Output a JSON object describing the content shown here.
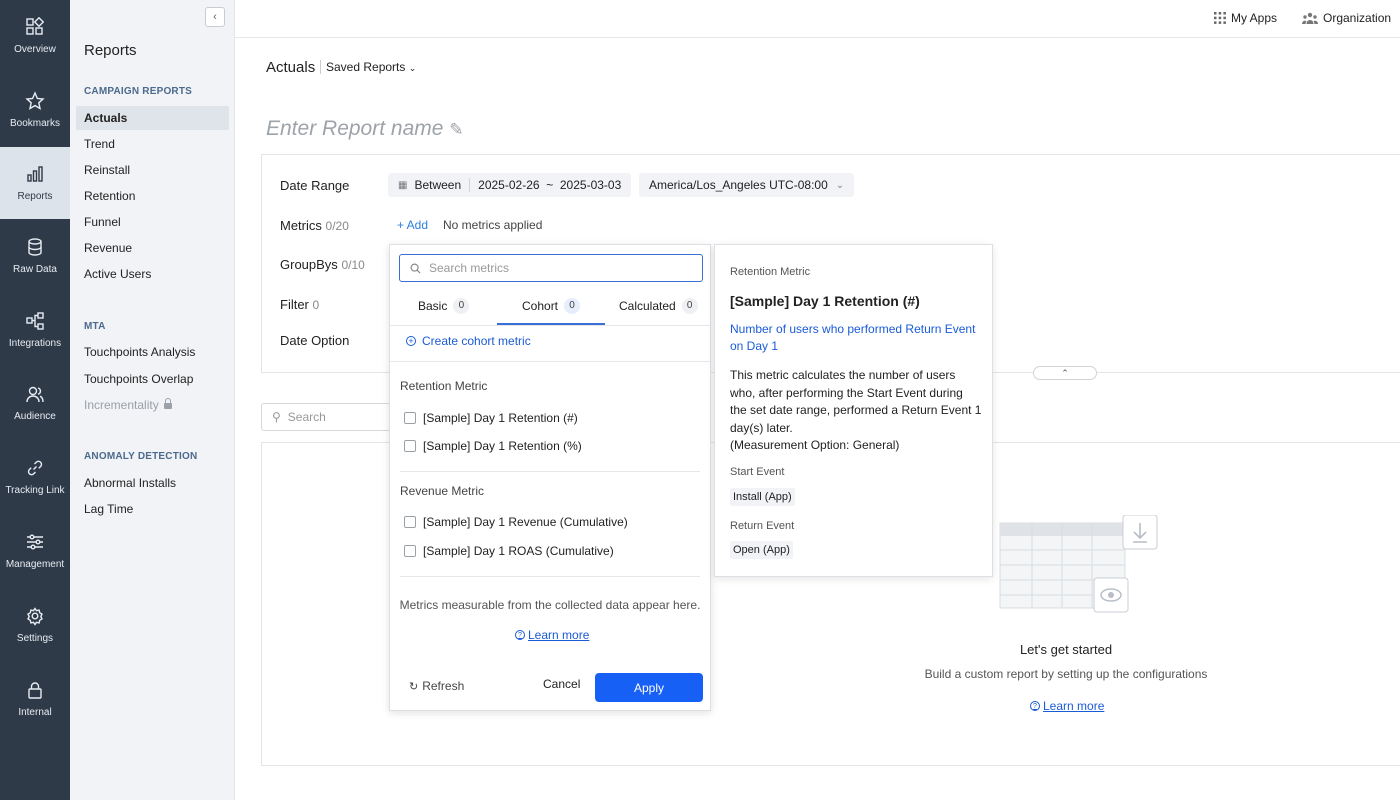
{
  "rail": {
    "items": [
      {
        "label": "Overview",
        "icon": "overview-icon"
      },
      {
        "label": "Bookmarks",
        "icon": "star-icon"
      },
      {
        "label": "Reports",
        "icon": "bar-chart-icon",
        "active": true
      },
      {
        "label": "Raw Data",
        "icon": "database-icon"
      },
      {
        "label": "Integrations",
        "icon": "integrations-icon"
      },
      {
        "label": "Audience",
        "icon": "users-icon"
      },
      {
        "label": "Tracking Link",
        "icon": "link-icon"
      },
      {
        "label": "Management",
        "icon": "sliders-icon"
      },
      {
        "label": "Settings",
        "icon": "gear-icon"
      },
      {
        "label": "Internal",
        "icon": "lock-icon"
      }
    ]
  },
  "sidebar": {
    "title": "Reports",
    "sections": [
      {
        "title": "CAMPAIGN REPORTS",
        "items": [
          "Actuals",
          "Trend",
          "Reinstall",
          "Retention",
          "Funnel",
          "Revenue",
          "Active Users"
        ]
      },
      {
        "title": "MTA",
        "items": [
          "Touchpoints Analysis",
          "Touchpoints Overlap",
          "Incrementality"
        ]
      },
      {
        "title": "ANOMALY DETECTION",
        "items": [
          "Abnormal Installs",
          "Lag Time"
        ]
      }
    ]
  },
  "topbar": {
    "my_apps": "My Apps",
    "organization": "Organization"
  },
  "header": {
    "title": "Actuals",
    "saved_reports": "Saved Reports"
  },
  "report_name_placeholder": "Enter Report name",
  "config": {
    "date_range_label": "Date Range",
    "date_mode": "Between",
    "date_value": "2025-02-26  ~  2025-03-03",
    "timezone": "America/Los_Angeles UTC-08:00",
    "metrics_label": "Metrics",
    "metrics_count": "0/20",
    "add": "+ Add",
    "no_metrics": "No metrics applied",
    "groupbys_label": "GroupBys",
    "groupbys_count": "0/10",
    "filter_label": "Filter",
    "filter_count": "0",
    "date_option_label": "Date Option"
  },
  "search_placeholder": "Search",
  "empty_state": {
    "title": "Let's get started",
    "subtitle": "Build a custom report by setting up the configurations",
    "learn_more": "Learn more"
  },
  "popup": {
    "search_placeholder": "Search metrics",
    "tabs": [
      {
        "label": "Basic",
        "count": "0"
      },
      {
        "label": "Cohort",
        "count": "0",
        "active": true
      },
      {
        "label": "Calculated",
        "count": "0"
      }
    ],
    "create_link": "Create cohort metric",
    "groups": [
      {
        "label": "Retention Metric",
        "items": [
          "[Sample] Day 1 Retention (#)",
          "[Sample] Day 1 Retention (%)"
        ]
      },
      {
        "label": "Revenue Metric",
        "items": [
          "[Sample] Day 1 Revenue (Cumulative)",
          "[Sample] Day 1 ROAS (Cumulative)"
        ]
      }
    ],
    "note": "Metrics measurable from the collected data appear here.",
    "learn_more": "Learn more",
    "refresh": "Refresh",
    "cancel": "Cancel",
    "apply": "Apply",
    "accent_color": "#1660f5"
  },
  "detail": {
    "kind": "Retention Metric",
    "title": "[Sample] Day 1 Retention (#)",
    "link": "Number of users who performed Return Event on Day 1",
    "description": "This metric calculates the number of users who, after performing the Start Event during the set date range, performed a Return Event 1 day(s) later.",
    "measurement": "(Measurement Option: General)",
    "start_event_label": "Start Event",
    "start_event": "Install (App)",
    "return_event_label": "Return Event",
    "return_event": "Open (App)"
  }
}
